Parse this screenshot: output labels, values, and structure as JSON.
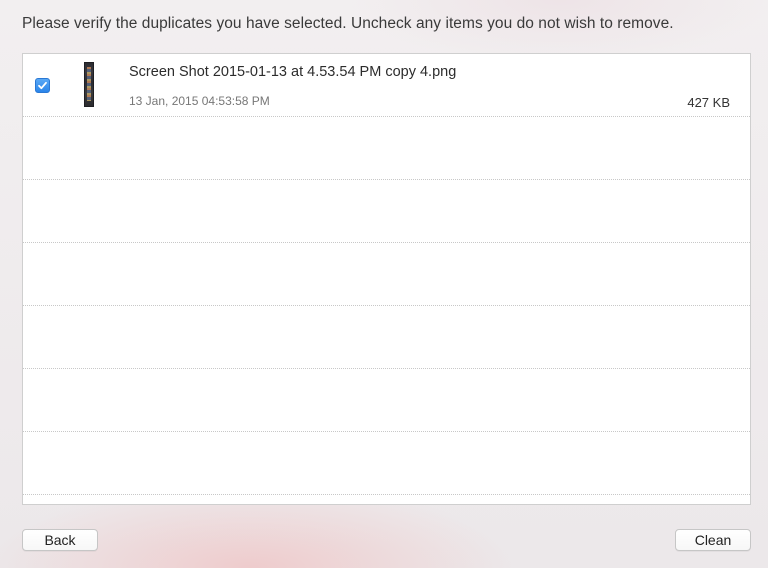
{
  "instruction": "Please verify the duplicates you have selected. Uncheck any items you do not wish to remove.",
  "items": [
    {
      "checked": true,
      "thumbnail": "screenshot-thumbnail",
      "name": "Screen Shot 2015-01-13 at 4.53.54 PM copy 4.png",
      "date": "13 Jan, 2015 04:53:58 PM",
      "size": "427 KB"
    }
  ],
  "buttons": {
    "back": "Back",
    "clean": "Clean"
  },
  "colors": {
    "checkbox_accent": "#2a85ea",
    "list_background": "#ffffff"
  },
  "icons": {
    "checkbox": "checkmark-icon"
  }
}
